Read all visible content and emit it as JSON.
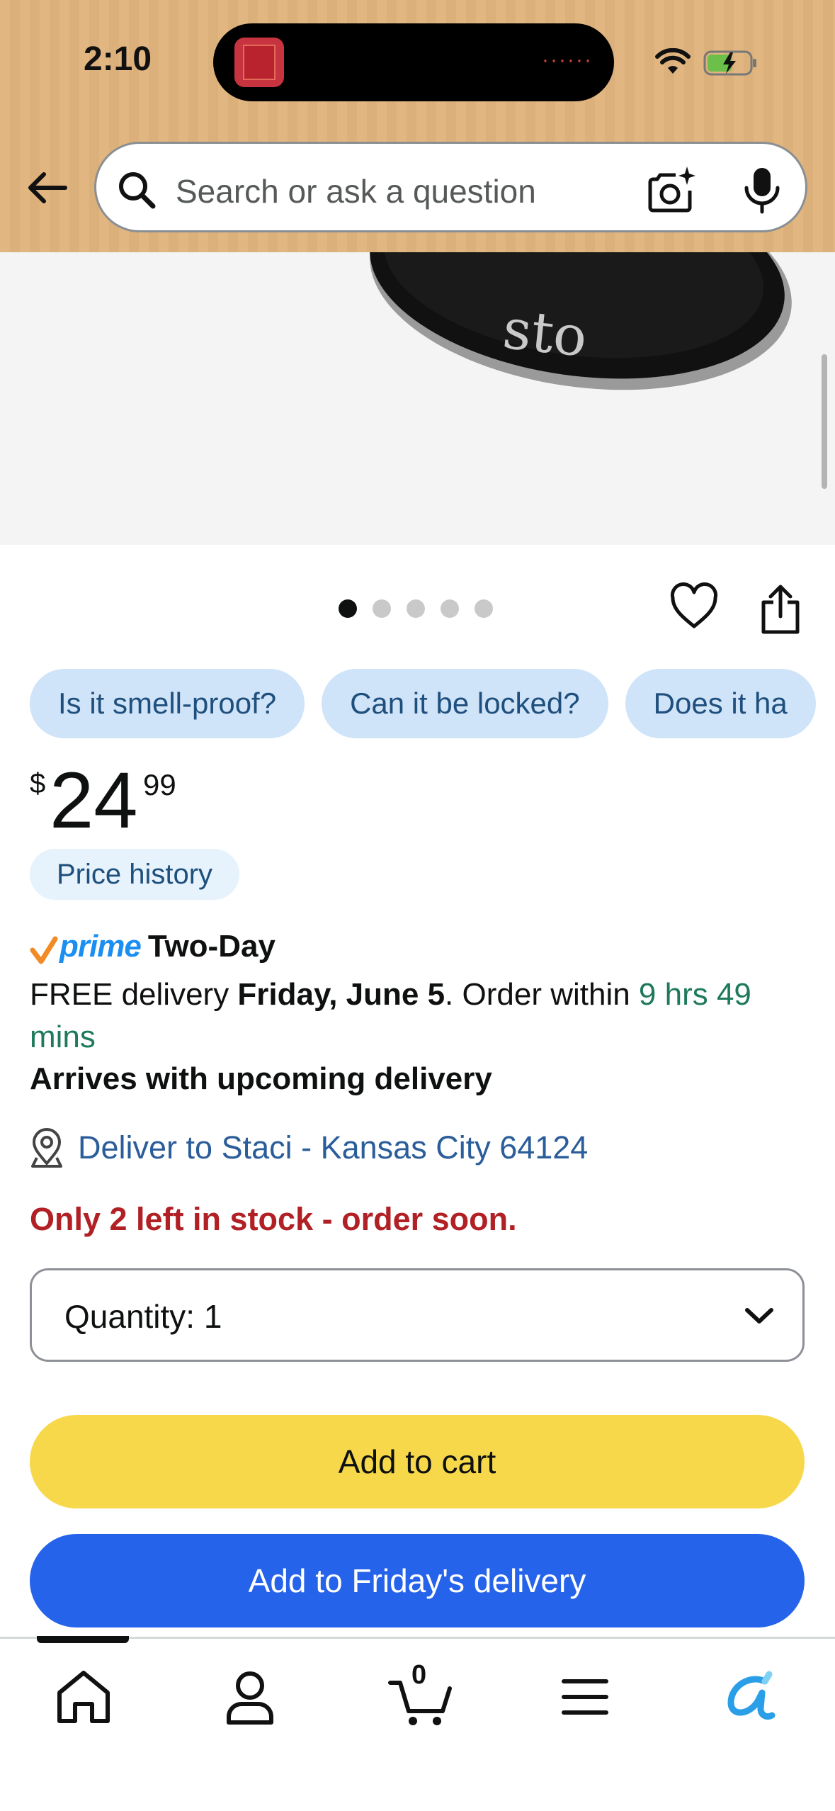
{
  "status_bar": {
    "time": "2:10"
  },
  "header": {
    "search_placeholder": "Search or ask a question",
    "background_color": "#e1b681"
  },
  "product_image": {
    "visible_text": "sto",
    "current_image": 1,
    "image_count": 5
  },
  "questions": [
    "Is it smell-proof?",
    "Can it be locked?",
    "Does it ha"
  ],
  "price": {
    "symbol": "$",
    "whole": "24",
    "fraction": "99",
    "history_label": "Price history"
  },
  "delivery": {
    "prime_word": "prime",
    "prime_type": "Two-Day",
    "free_prefix": "FREE delivery ",
    "date": "Friday, June 5",
    "order_within": ". Order within ",
    "countdown": "9 hrs 49 mins",
    "arrives": "Arrives with upcoming delivery",
    "deliver_to": "Deliver to Staci - Kansas City 64124",
    "stock": "Only 2 left in stock - order soon."
  },
  "purchase": {
    "quantity_label": "Quantity:",
    "quantity_value": "1",
    "add_to_cart": "Add to cart",
    "add_to_delivery": "Add to Friday's delivery"
  },
  "bottom_nav": {
    "items": [
      "home-icon",
      "account-icon",
      "cart-icon",
      "menu-icon",
      "rufus-icon"
    ],
    "cart_count": "0"
  },
  "colors": {
    "primary_button": "#f7d84a",
    "secondary_button": "#2563eb",
    "link": "#2a5d99",
    "stock_warning": "#b12025",
    "countdown": "#1f7a5c"
  }
}
